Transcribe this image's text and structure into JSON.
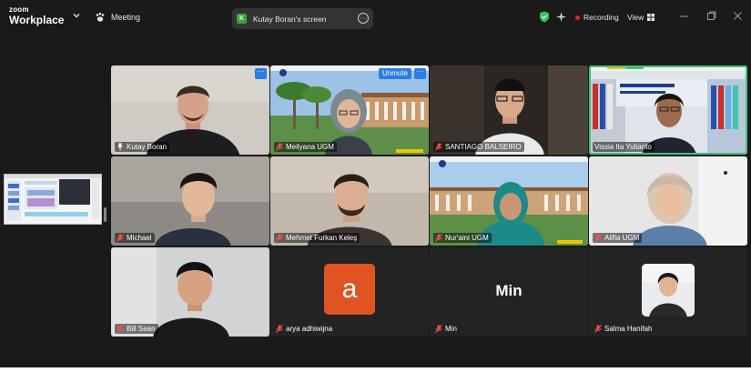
{
  "app": {
    "logo_line1": "zoom",
    "logo_line2": "Workplace",
    "meeting_label": "Meeting",
    "screen_share": {
      "initial": "K",
      "label": "Kutay Boran's screen",
      "more_icon": "ellipsis-circle-icon"
    },
    "recording_label": "Recording",
    "view_label": "View"
  },
  "colors": {
    "background": "#1a1a1a",
    "accent_blue": "#2b7de9",
    "active_speaker": "#3ec47b",
    "recording_red": "#e02828",
    "avatar_orange": "#e05423",
    "shield_green": "#39c15a"
  },
  "participants": [
    {
      "name": "Kutay Boran",
      "icon": "pin-icon",
      "muted": false
    },
    {
      "name": "Meilyana UGM",
      "icon": "mic-muted-icon",
      "muted": true,
      "unmute_label": "Unmute"
    },
    {
      "name": "SANTIAGO BALSEIRO",
      "icon": "mic-muted-icon",
      "muted": true
    },
    {
      "name": "Vissia Ita Yulianto",
      "icon": "none",
      "muted": false,
      "active_speaker": true
    },
    {
      "name": "Michael",
      "icon": "mic-muted-icon",
      "muted": true
    },
    {
      "name": "Mehmet Furkan Keleş",
      "icon": "mic-muted-icon",
      "muted": true
    },
    {
      "name": "Nur'aini UGM",
      "icon": "mic-muted-icon",
      "muted": true
    },
    {
      "name": "Alifia UGM",
      "icon": "mic-muted-icon",
      "muted": true
    },
    {
      "name": "Bill Sean",
      "icon": "mic-muted-icon",
      "muted": true
    },
    {
      "name": "arya adhiwijna",
      "icon": "mic-muted-icon",
      "muted": true,
      "avatar_letter": "a"
    },
    {
      "name": "Min",
      "icon": "mic-muted-icon",
      "muted": true,
      "avatar_text": "Min"
    },
    {
      "name": "Salma Hanifah",
      "icon": "mic-muted-icon",
      "muted": true
    }
  ],
  "tile_more_label": "···"
}
